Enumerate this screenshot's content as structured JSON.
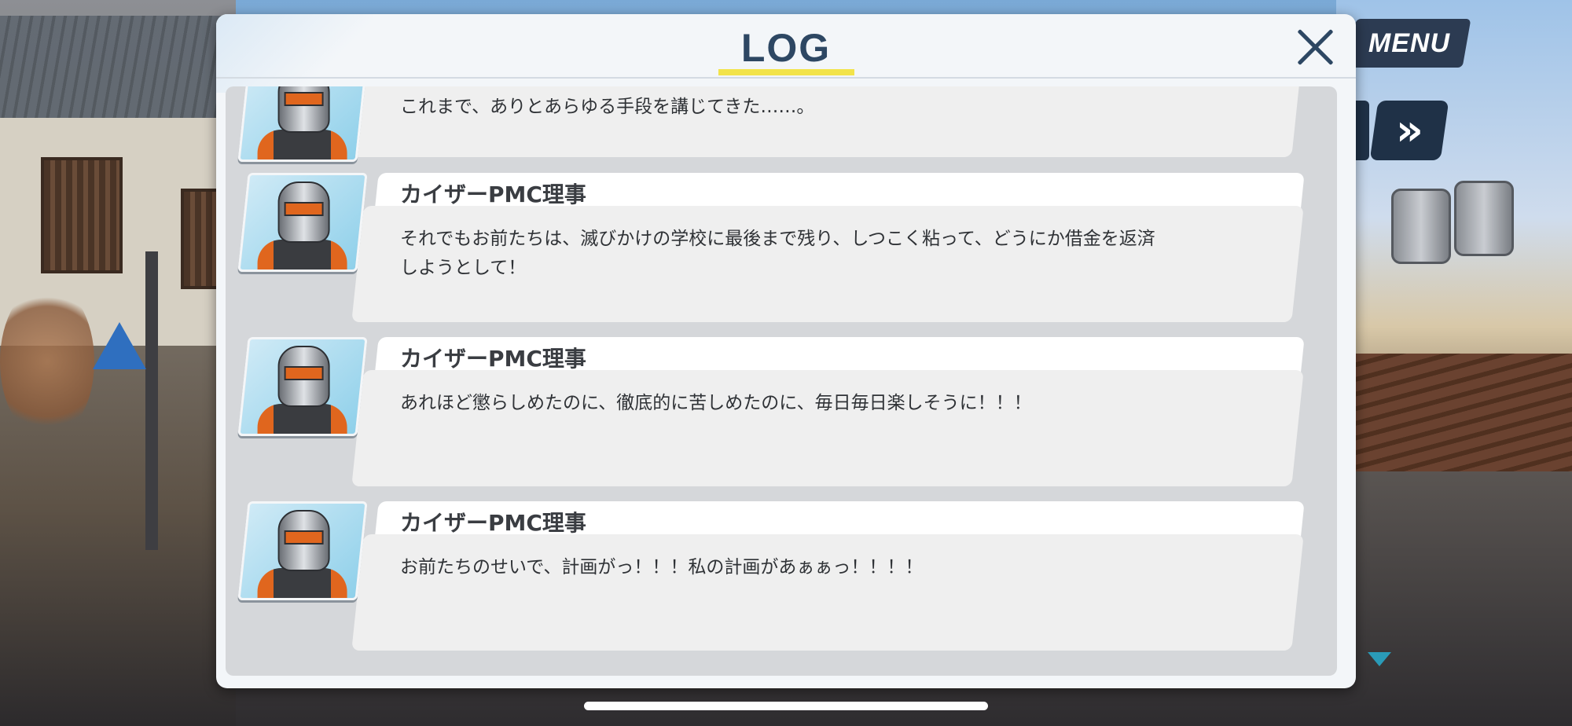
{
  "hud": {
    "menu_label": "MENU",
    "skip_glyph": "»",
    "scroll_indicator": "down-arrow"
  },
  "log_window": {
    "title": "LOG",
    "close_icon": "close-icon",
    "accent_color": "#f2e34a",
    "title_color": "#2d4763",
    "entries": [
      {
        "speaker": "",
        "avatar": "robot-helmet-avatar",
        "text": "これまで、ありとあらゆる手段を講じてきた……。"
      },
      {
        "speaker": "カイザーPMC理事",
        "avatar": "robot-helmet-avatar",
        "text": "それでもお前たちは、滅びかけの学校に最後まで残り、しつこく粘って、どうにか借金を返済\nしようとして！"
      },
      {
        "speaker": "カイザーPMC理事",
        "avatar": "robot-helmet-avatar",
        "text": "あれほど懲らしめたのに、徹底的に苦しめたのに、毎日毎日楽しそうに！！！"
      },
      {
        "speaker": "カイザーPMC理事",
        "avatar": "robot-helmet-avatar",
        "text": "お前たちのせいで、計画がっ！！！私の計画があぁぁっ！！！！"
      }
    ]
  }
}
